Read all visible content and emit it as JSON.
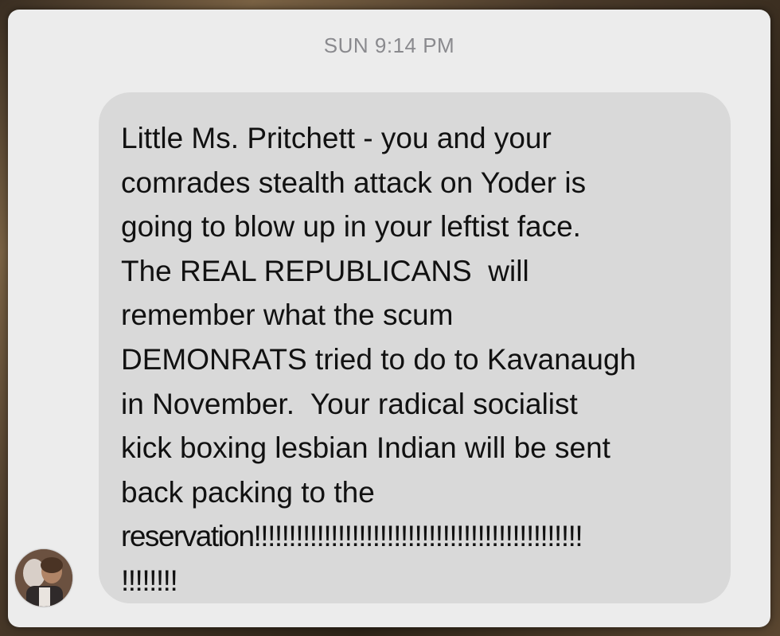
{
  "conversation": {
    "timestamp": "SUN 9:14 PM",
    "message": {
      "lines": [
        "Little Ms. Pritchett - you and your",
        "comrades stealth attack on Yoder is",
        "going to blow up in your leftist face.",
        "The REAL REPUBLICANS  will",
        "remember what the scum",
        "DEMONRATS tried to do to Kavanaugh",
        "in November.  Your radical socialist",
        "kick boxing lesbian Indian will be sent",
        "back packing to the",
        "reservation!!!!!!!!!!!!!!!!!!!!!!!!!!!!!!!!!!!!!!!!!!!!!!!",
        "!!!!!!!!"
      ]
    },
    "sender": {
      "avatar_icon": "contact-avatar"
    }
  }
}
